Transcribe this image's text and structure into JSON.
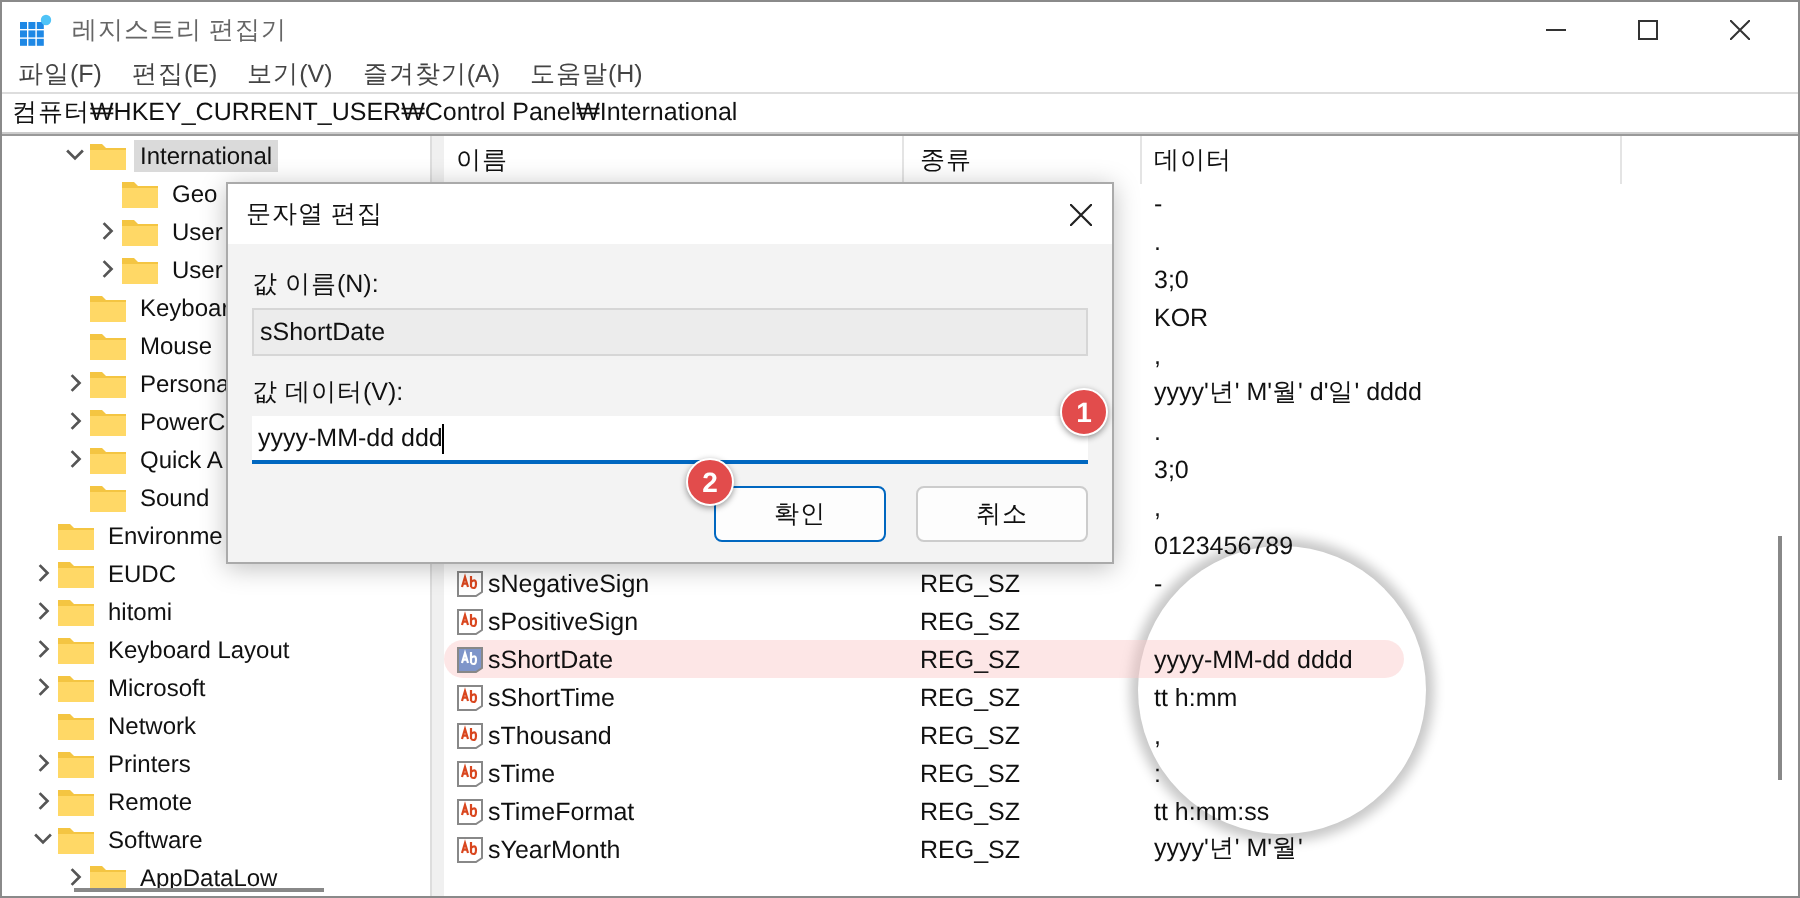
{
  "window": {
    "title": "레지스트리 편집기"
  },
  "menu": [
    "파일(F)",
    "편집(E)",
    "보기(V)",
    "즐겨찾기(A)",
    "도움말(H)"
  ],
  "address": "컴퓨터₩HKEY_CURRENT_USER₩Control Panel₩International",
  "tree": [
    {
      "children": [
        {
          "label": "International",
          "expandable": true,
          "expanded": true,
          "selected": true,
          "children": [
            {
              "label": "Geo",
              "expandable": false,
              "selected": false
            },
            {
              "label": "User",
              "expandable": true,
              "expanded": false,
              "selected": false
            },
            {
              "label": "User",
              "expandable": true,
              "expanded": false,
              "selected": false
            }
          ]
        },
        {
          "label": "Keyboar",
          "expandable": false,
          "selected": false
        },
        {
          "label": "Mouse",
          "expandable": false,
          "selected": false
        },
        {
          "label": "Persona",
          "expandable": true,
          "expanded": false,
          "selected": false
        },
        {
          "label": "PowerC",
          "expandable": true,
          "expanded": false,
          "selected": false
        },
        {
          "label": "Quick A",
          "expandable": true,
          "expanded": false,
          "selected": false
        },
        {
          "label": "Sound",
          "expandable": false,
          "selected": false
        }
      ]
    },
    {
      "label": "Environme",
      "expandable": false,
      "selected": false
    },
    {
      "label": "EUDC",
      "expandable": true,
      "expanded": false,
      "selected": false
    },
    {
      "label": "hitomi",
      "expandable": true,
      "expanded": false,
      "selected": false
    },
    {
      "label": "Keyboard Layout",
      "expandable": true,
      "expanded": false,
      "selected": false
    },
    {
      "label": "Microsoft",
      "expandable": true,
      "expanded": false,
      "selected": false
    },
    {
      "label": "Network",
      "expandable": false,
      "selected": false
    },
    {
      "label": "Printers",
      "expandable": true,
      "expanded": false,
      "selected": false
    },
    {
      "label": "Remote",
      "expandable": true,
      "expanded": false,
      "selected": false
    },
    {
      "label": "Software",
      "expandable": true,
      "expanded": true,
      "selected": false,
      "children": [
        {
          "label": "AppDataLow",
          "expandable": true,
          "expanded": false,
          "selected": false
        }
      ]
    }
  ],
  "table": {
    "columns": [
      "이름",
      "종류",
      "데이터"
    ],
    "rows": [
      {
        "data": "-",
        "highlighted": false
      },
      {
        "data": ".",
        "highlighted": false
      },
      {
        "data": "3;0",
        "highlighted": false
      },
      {
        "data": "KOR",
        "highlighted": false
      },
      {
        "data": ",",
        "highlighted": false
      },
      {
        "data": "yyyy'년' M'월' d'일' dddd",
        "highlighted": false
      },
      {
        "data": ".",
        "highlighted": false
      },
      {
        "data": "3;0",
        "highlighted": false
      },
      {
        "data": ",",
        "highlighted": false
      },
      {
        "data": "0123456789",
        "highlighted": false
      },
      {
        "name": "sNegativeSign",
        "type": "REG_SZ",
        "data": "-",
        "highlighted": false
      },
      {
        "name": "sPositiveSign",
        "type": "REG_SZ",
        "highlighted": false
      },
      {
        "name": "sShortDate",
        "type": "REG_SZ",
        "data": "yyyy-MM-dd dddd",
        "highlighted": true
      },
      {
        "name": "sShortTime",
        "type": "REG_SZ",
        "data": "tt h:mm",
        "highlighted": false
      },
      {
        "name": "sThousand",
        "type": "REG_SZ",
        "data": ",",
        "highlighted": false
      },
      {
        "name": "sTime",
        "type": "REG_SZ",
        "data": ":",
        "highlighted": false
      },
      {
        "name": "sTimeFormat",
        "type": "REG_SZ",
        "data": "tt h:mm:ss",
        "highlighted": false
      },
      {
        "name": "sYearMonth",
        "type": "REG_SZ",
        "data": "yyyy'년' M'월'",
        "highlighted": false
      }
    ]
  },
  "dialog": {
    "title": "문자열 편집",
    "name_label": "값 이름(N):",
    "name_value": "sShortDate",
    "data_label": "값 데이터(V):",
    "data_value": "yyyy-MM-dd ddd",
    "data_marker": "1",
    "buttons": [
      {
        "label": "확인",
        "default": true,
        "marker": "2"
      },
      {
        "label": "취소",
        "default": false
      }
    ]
  }
}
